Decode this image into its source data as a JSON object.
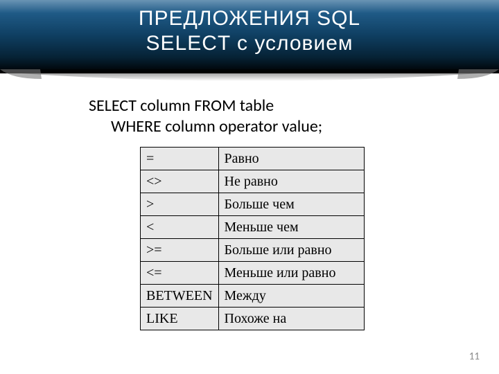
{
  "header": {
    "line1": "ПРЕДЛОЖЕНИЯ SQL",
    "line2": "SELECT с условием"
  },
  "code": {
    "line1": "SELECT column FROM table",
    "line2": "WHERE column operator value;"
  },
  "operators": [
    {
      "op": "=",
      "desc": "Равно"
    },
    {
      "op": "<>",
      "desc": "Не равно"
    },
    {
      "op": ">",
      "desc": "Больше чем"
    },
    {
      "op": "<",
      "desc": "Меньше чем"
    },
    {
      "op": ">=",
      "desc": "Больше или равно"
    },
    {
      "op": "<=",
      "desc": "Меньше или равно"
    },
    {
      "op": "BETWEEN",
      "desc": "Между"
    },
    {
      "op": "LIKE",
      "desc": "Похоже на"
    }
  ],
  "page_number": "11"
}
